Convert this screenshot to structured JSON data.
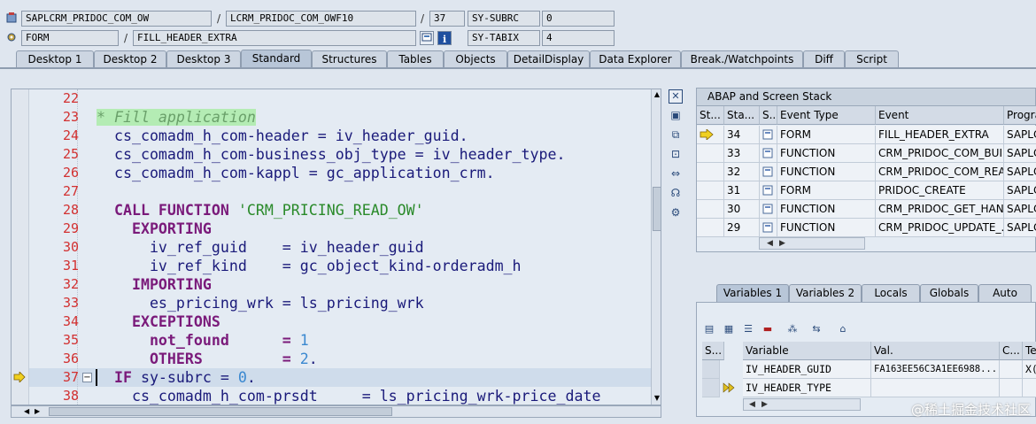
{
  "header": {
    "row1": {
      "program": "SAPLCRM_PRIDOC_COM_OW",
      "include": "LCRM_PRIDOC_COM_OWF10",
      "line": "37",
      "sysvar": "SY-SUBRC",
      "sysval": "0"
    },
    "row2": {
      "type": "FORM",
      "name": "FILL_HEADER_EXTRA",
      "sysvar": "SY-TABIX",
      "sysval": "4"
    },
    "sep": "/"
  },
  "tabs": [
    "Desktop 1",
    "Desktop 2",
    "Desktop 3",
    "Standard",
    "Structures",
    "Tables",
    "Objects",
    "DetailDisplay",
    "Data Explorer",
    "Break./Watchpoints",
    "Diff",
    "Script"
  ],
  "active_tab": "Standard",
  "editor": {
    "line_numbers": [
      "22",
      "23",
      "24",
      "25",
      "26",
      "27",
      "28",
      "29",
      "30",
      "31",
      "32",
      "33",
      "34",
      "35",
      "36",
      "37",
      "38"
    ],
    "lines": {
      "l23": "* Fill application",
      "l24": "  cs_comadm_h_com-header = iv_header_guid.",
      "l25": "  cs_comadm_h_com-business_obj_type = iv_header_type.",
      "l26": "  cs_comadm_h_com-kappl = gc_application_crm.",
      "l28_kw": "  CALL FUNCTION ",
      "l28_str": "'CRM_PRICING_READ_OW'",
      "l29": "    EXPORTING",
      "l30": "      iv_ref_guid    = iv_header_guid",
      "l31": "      iv_ref_kind    = gc_object_kind-orderadm_h",
      "l32": "    IMPORTING",
      "l33": "      es_pricing_wrk = ls_pricing_wrk",
      "l34": "    EXCEPTIONS",
      "l35_a": "      not_found      = ",
      "l35_n": "1",
      "l36_a": "      OTHERS         = ",
      "l36_n": "2",
      "l36_b": ".",
      "l37_kw": "  IF ",
      "l37_a": "sy-subrc = ",
      "l37_n": "0",
      "l37_b": ".",
      "l38": "    cs_comadm_h_com-prsdt     = ls_pricing_wrk-price_date"
    }
  },
  "stack": {
    "title": "ABAP and Screen Stack",
    "columns": [
      "St...",
      "Sta...",
      "S...",
      "Event Type",
      "Event",
      "Progra"
    ],
    "rows": [
      {
        "level": "34",
        "type": "FORM",
        "event": "FILL_HEADER_EXTRA",
        "prog": "SAPLC",
        "current": true
      },
      {
        "level": "33",
        "type": "FUNCTION",
        "event": "CRM_PRIDOC_COM_BUIL...",
        "prog": "SAPLC",
        "current": false
      },
      {
        "level": "32",
        "type": "FUNCTION",
        "event": "CRM_PRIDOC_COM_REA...",
        "prog": "SAPLC",
        "current": false
      },
      {
        "level": "31",
        "type": "FORM",
        "event": "PRIDOC_CREATE",
        "prog": "SAPLC",
        "current": false
      },
      {
        "level": "30",
        "type": "FUNCTION",
        "event": "CRM_PRIDOC_GET_HAN...",
        "prog": "SAPLC",
        "current": false
      },
      {
        "level": "29",
        "type": "FUNCTION",
        "event": "CRM_PRIDOC_UPDATE_...",
        "prog": "SAPLC",
        "current": false
      }
    ]
  },
  "var_tabs": [
    "Variables 1",
    "Variables 2",
    "Locals",
    "Globals",
    "Auto"
  ],
  "active_var_tab": "Variables 1",
  "variables": {
    "columns": [
      "S...",
      "Variable",
      "Val.",
      "C...",
      "Te"
    ],
    "rows": [
      {
        "name": "IV_HEADER_GUID",
        "value": "FA163EE56C3A1EE6988...",
        "type": "X(1"
      },
      {
        "name": "IV_HEADER_TYPE",
        "value": "",
        "type": ""
      }
    ]
  },
  "watermark": "@稀土掘金技术社区"
}
